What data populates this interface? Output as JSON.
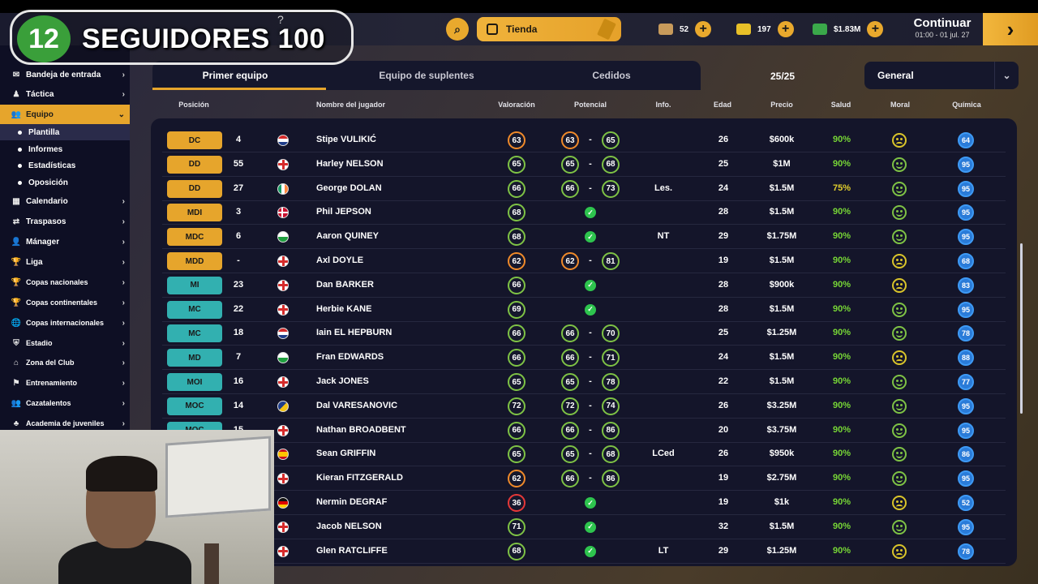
{
  "overlay": {
    "count": "12",
    "text": "SEGUIDORES 100"
  },
  "topbar": {
    "shop_label": "Tienda",
    "currencies": [
      {
        "icon": "scout-ticket-icon",
        "value": "52",
        "color": "#c79a5b"
      },
      {
        "icon": "gold-bars-icon",
        "value": "197",
        "color": "#e8c028"
      },
      {
        "icon": "cash-icon",
        "value": "$1.83M",
        "color": "#3aa84a"
      }
    ],
    "continue_label": "Continuar",
    "continue_date": "01:00 - 01 jul. 27"
  },
  "sidebar": {
    "items": [
      {
        "label": "Bandeja de entrada",
        "icon": "inbox-icon",
        "glyph": "✉"
      },
      {
        "label": "Táctica",
        "icon": "tactics-icon",
        "glyph": "♟"
      },
      {
        "label": "Equipo",
        "icon": "team-icon",
        "glyph": "👥"
      },
      {
        "label": "Calendario",
        "icon": "calendar-icon",
        "glyph": "▦"
      },
      {
        "label": "Traspasos",
        "icon": "transfers-icon",
        "glyph": "⇄"
      },
      {
        "label": "Mánager",
        "icon": "manager-icon",
        "glyph": "👤"
      },
      {
        "label": "Liga",
        "icon": "trophy-icon",
        "glyph": "🏆"
      },
      {
        "label": "Copas nacionales",
        "icon": "cup-icon",
        "glyph": "🏆"
      },
      {
        "label": "Copas continentales",
        "icon": "continental-cup-icon",
        "glyph": "🏆"
      },
      {
        "label": "Copas internacionales",
        "icon": "globe-icon",
        "glyph": "🌐"
      },
      {
        "label": "Estadio",
        "icon": "stadium-icon",
        "glyph": "⛨"
      },
      {
        "label": "Zona del Club",
        "icon": "club-zone-icon",
        "glyph": "⌂"
      },
      {
        "label": "Entrenamiento",
        "icon": "training-icon",
        "glyph": "⚑"
      },
      {
        "label": "Cazatalentos",
        "icon": "scout-icon",
        "glyph": "👥"
      },
      {
        "label": "Academia de juveniles",
        "icon": "academy-icon",
        "glyph": "♣"
      }
    ],
    "subitems": [
      "Plantilla",
      "Informes",
      "Estadísticas",
      "Oposición"
    ]
  },
  "tabs": [
    "Primer equipo",
    "Equipo de suplentes",
    "Cedidos"
  ],
  "squad_count": "25/25",
  "filter": {
    "selected": "General"
  },
  "columns": {
    "position": "Posición",
    "name": "Nombre del jugador",
    "rating": "Valoración",
    "potential": "Potencial",
    "info": "Info.",
    "age": "Edad",
    "price": "Precio",
    "health": "Salud",
    "moral": "Moral",
    "chemistry": "Química"
  },
  "rows": [
    {
      "pos": "DC",
      "group": "def",
      "num": "4",
      "flag": "CRO",
      "name": "Stipe VULIKIĆ",
      "rating": "63",
      "rc": "orange",
      "pot_min": "63",
      "pmc": "orange",
      "pot_max": "65",
      "info": "",
      "age": "26",
      "price": "$600k",
      "health": "90%",
      "moral": "neutral",
      "chem": "64"
    },
    {
      "pos": "DD",
      "group": "def",
      "num": "55",
      "flag": "ENG",
      "name": "Harley NELSON",
      "rating": "65",
      "rc": "green",
      "pot_min": "65",
      "pmc": "green",
      "pot_max": "68",
      "info": "",
      "age": "25",
      "price": "$1M",
      "health": "90%",
      "moral": "happy",
      "chem": "95"
    },
    {
      "pos": "DD",
      "group": "def",
      "num": "27",
      "flag": "IRL",
      "name": "George DOLAN",
      "rating": "66",
      "rc": "green",
      "pot_min": "66",
      "pmc": "green",
      "pot_max": "73",
      "info": "Les.",
      "age": "24",
      "price": "$1.5M",
      "health": "75%",
      "moral": "happy",
      "chem": "95"
    },
    {
      "pos": "MDI",
      "group": "def",
      "num": "3",
      "flag": "DEN",
      "name": "Phil JEPSON",
      "rating": "68",
      "rc": "green",
      "pot_min": "",
      "pmc": "",
      "pot_max": "",
      "info": "",
      "age": "28",
      "price": "$1.5M",
      "health": "90%",
      "moral": "happy",
      "chem": "95"
    },
    {
      "pos": "MDC",
      "group": "def",
      "num": "6",
      "flag": "WAL",
      "name": "Aaron QUINEY",
      "rating": "68",
      "rc": "green",
      "pot_min": "",
      "pmc": "",
      "pot_max": "",
      "info": "NT",
      "age": "29",
      "price": "$1.75M",
      "health": "90%",
      "moral": "happy",
      "chem": "95"
    },
    {
      "pos": "MDD",
      "group": "def",
      "num": "-",
      "flag": "ENG",
      "name": "Axl DOYLE",
      "rating": "62",
      "rc": "orange",
      "pot_min": "62",
      "pmc": "orange",
      "pot_max": "81",
      "info": "",
      "age": "19",
      "price": "$1.5M",
      "health": "90%",
      "moral": "neutral",
      "chem": "68"
    },
    {
      "pos": "MI",
      "group": "mid",
      "num": "23",
      "flag": "ENG",
      "name": "Dan BARKER",
      "rating": "66",
      "rc": "green",
      "pot_min": "",
      "pmc": "",
      "pot_max": "",
      "info": "",
      "age": "28",
      "price": "$900k",
      "health": "90%",
      "moral": "neutral",
      "chem": "83"
    },
    {
      "pos": "MC",
      "group": "mid",
      "num": "22",
      "flag": "ENG",
      "name": "Herbie KANE",
      "rating": "69",
      "rc": "green",
      "pot_min": "",
      "pmc": "",
      "pot_max": "",
      "info": "",
      "age": "28",
      "price": "$1.5M",
      "health": "90%",
      "moral": "happy",
      "chem": "95"
    },
    {
      "pos": "MC",
      "group": "mid",
      "num": "18",
      "flag": "PAR",
      "name": "Iain EL HEPBURN",
      "rating": "66",
      "rc": "green",
      "pot_min": "66",
      "pmc": "green",
      "pot_max": "70",
      "info": "",
      "age": "25",
      "price": "$1.25M",
      "health": "90%",
      "moral": "happy",
      "chem": "78"
    },
    {
      "pos": "MD",
      "group": "mid",
      "num": "7",
      "flag": "WAL",
      "name": "Fran EDWARDS",
      "rating": "66",
      "rc": "green",
      "pot_min": "66",
      "pmc": "green",
      "pot_max": "71",
      "info": "",
      "age": "24",
      "price": "$1.5M",
      "health": "90%",
      "moral": "neutral",
      "chem": "88"
    },
    {
      "pos": "MOI",
      "group": "mid",
      "num": "16",
      "flag": "ENG",
      "name": "Jack JONES",
      "rating": "65",
      "rc": "green",
      "pot_min": "65",
      "pmc": "green",
      "pot_max": "78",
      "info": "",
      "age": "22",
      "price": "$1.5M",
      "health": "90%",
      "moral": "happy",
      "chem": "77"
    },
    {
      "pos": "MOC",
      "group": "mid",
      "num": "14",
      "flag": "BIH",
      "name": "Dal VARESANOVIC",
      "rating": "72",
      "rc": "green",
      "pot_min": "72",
      "pmc": "green",
      "pot_max": "74",
      "info": "",
      "age": "26",
      "price": "$3.25M",
      "health": "90%",
      "moral": "happy",
      "chem": "95"
    },
    {
      "pos": "MOC",
      "group": "mid",
      "num": "15",
      "flag": "ENG",
      "name": "Nathan BROADBENT",
      "rating": "66",
      "rc": "green",
      "pot_min": "66",
      "pmc": "green",
      "pot_max": "86",
      "info": "",
      "age": "20",
      "price": "$3.75M",
      "health": "90%",
      "moral": "happy",
      "chem": "95"
    },
    {
      "pos": "",
      "group": "",
      "num": "",
      "flag": "ESP",
      "name": "Sean GRIFFIN",
      "rating": "65",
      "rc": "green",
      "pot_min": "65",
      "pmc": "green",
      "pot_max": "68",
      "info": "LCed",
      "age": "26",
      "price": "$950k",
      "health": "90%",
      "moral": "happy",
      "chem": "86"
    },
    {
      "pos": "",
      "group": "",
      "num": "",
      "flag": "ENG",
      "name": "Kieran FITZGERALD",
      "rating": "62",
      "rc": "orange",
      "pot_min": "66",
      "pmc": "green",
      "pot_max": "86",
      "info": "",
      "age": "19",
      "price": "$2.75M",
      "health": "90%",
      "moral": "happy",
      "chem": "95"
    },
    {
      "pos": "",
      "group": "",
      "num": "",
      "flag": "GER",
      "name": "Nermin DEGRAF",
      "rating": "36",
      "rc": "red",
      "pot_min": "",
      "pmc": "",
      "pot_max": "",
      "info": "",
      "age": "19",
      "price": "$1k",
      "health": "90%",
      "moral": "neutral",
      "chem": "52"
    },
    {
      "pos": "",
      "group": "",
      "num": "",
      "flag": "ENG",
      "name": "Jacob NELSON",
      "rating": "71",
      "rc": "green",
      "pot_min": "",
      "pmc": "",
      "pot_max": "",
      "info": "",
      "age": "32",
      "price": "$1.5M",
      "health": "90%",
      "moral": "happy",
      "chem": "95"
    },
    {
      "pos": "",
      "group": "",
      "num": "",
      "flag": "ENG",
      "name": "Glen RATCLIFFE",
      "rating": "68",
      "rc": "green",
      "pot_min": "",
      "pmc": "",
      "pot_max": "",
      "info": "LT",
      "age": "29",
      "price": "$1.25M",
      "health": "90%",
      "moral": "neutral",
      "chem": "78"
    }
  ],
  "colors": {
    "accent": "#e6a52c",
    "midfield": "#32b0b0",
    "good": "#7ec245",
    "warn": "#f08a2a",
    "bad": "#e53838",
    "chem": "#2a7bd8"
  }
}
